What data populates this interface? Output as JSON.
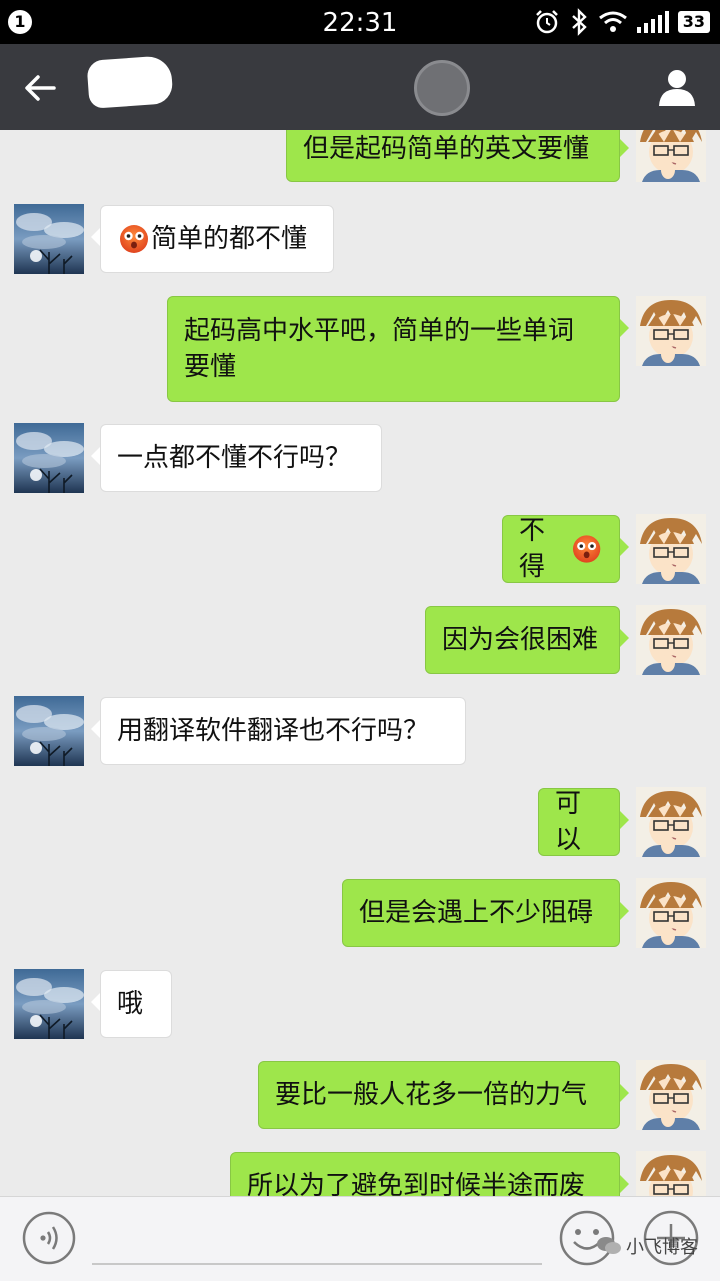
{
  "status_bar": {
    "notification_count": "1",
    "time": "22:31",
    "battery": "33"
  },
  "header": {
    "title": "",
    "icons": [
      "back-arrow-icon",
      "profile-icon"
    ]
  },
  "messages": [
    {
      "side": "me",
      "text": "但是起码简单的英文要懂"
    },
    {
      "side": "them",
      "emoji_before": "shocked-face-emoji",
      "text": "简单的都不懂"
    },
    {
      "side": "me",
      "lines": [
        "起码高中水平吧，简单的一些单词",
        "要懂"
      ]
    },
    {
      "side": "them",
      "text": "一点都不懂不行吗？"
    },
    {
      "side": "me",
      "text": "不得",
      "emoji_after": "shocked-face-emoji"
    },
    {
      "side": "me",
      "text": "因为会很困难"
    },
    {
      "side": "them",
      "text": "用翻译软件翻译也不行吗？"
    },
    {
      "side": "me",
      "text": "可以"
    },
    {
      "side": "me",
      "text": "但是会遇上不少阻碍"
    },
    {
      "side": "them",
      "text": "哦"
    },
    {
      "side": "me",
      "text": "要比一般人花多一倍的力气"
    },
    {
      "side": "me",
      "text": "所以为了避免到时候半途而废"
    }
  ],
  "input_bar": {
    "text_value": "",
    "watermark": "小飞博客",
    "icons": [
      "voice-icon",
      "emoji-icon",
      "plus-icon"
    ]
  },
  "colors": {
    "my_bubble": "#9ee64b",
    "their_bubble": "#ffffff",
    "background": "#ebebeb",
    "nav_bar": "#393a3f"
  }
}
